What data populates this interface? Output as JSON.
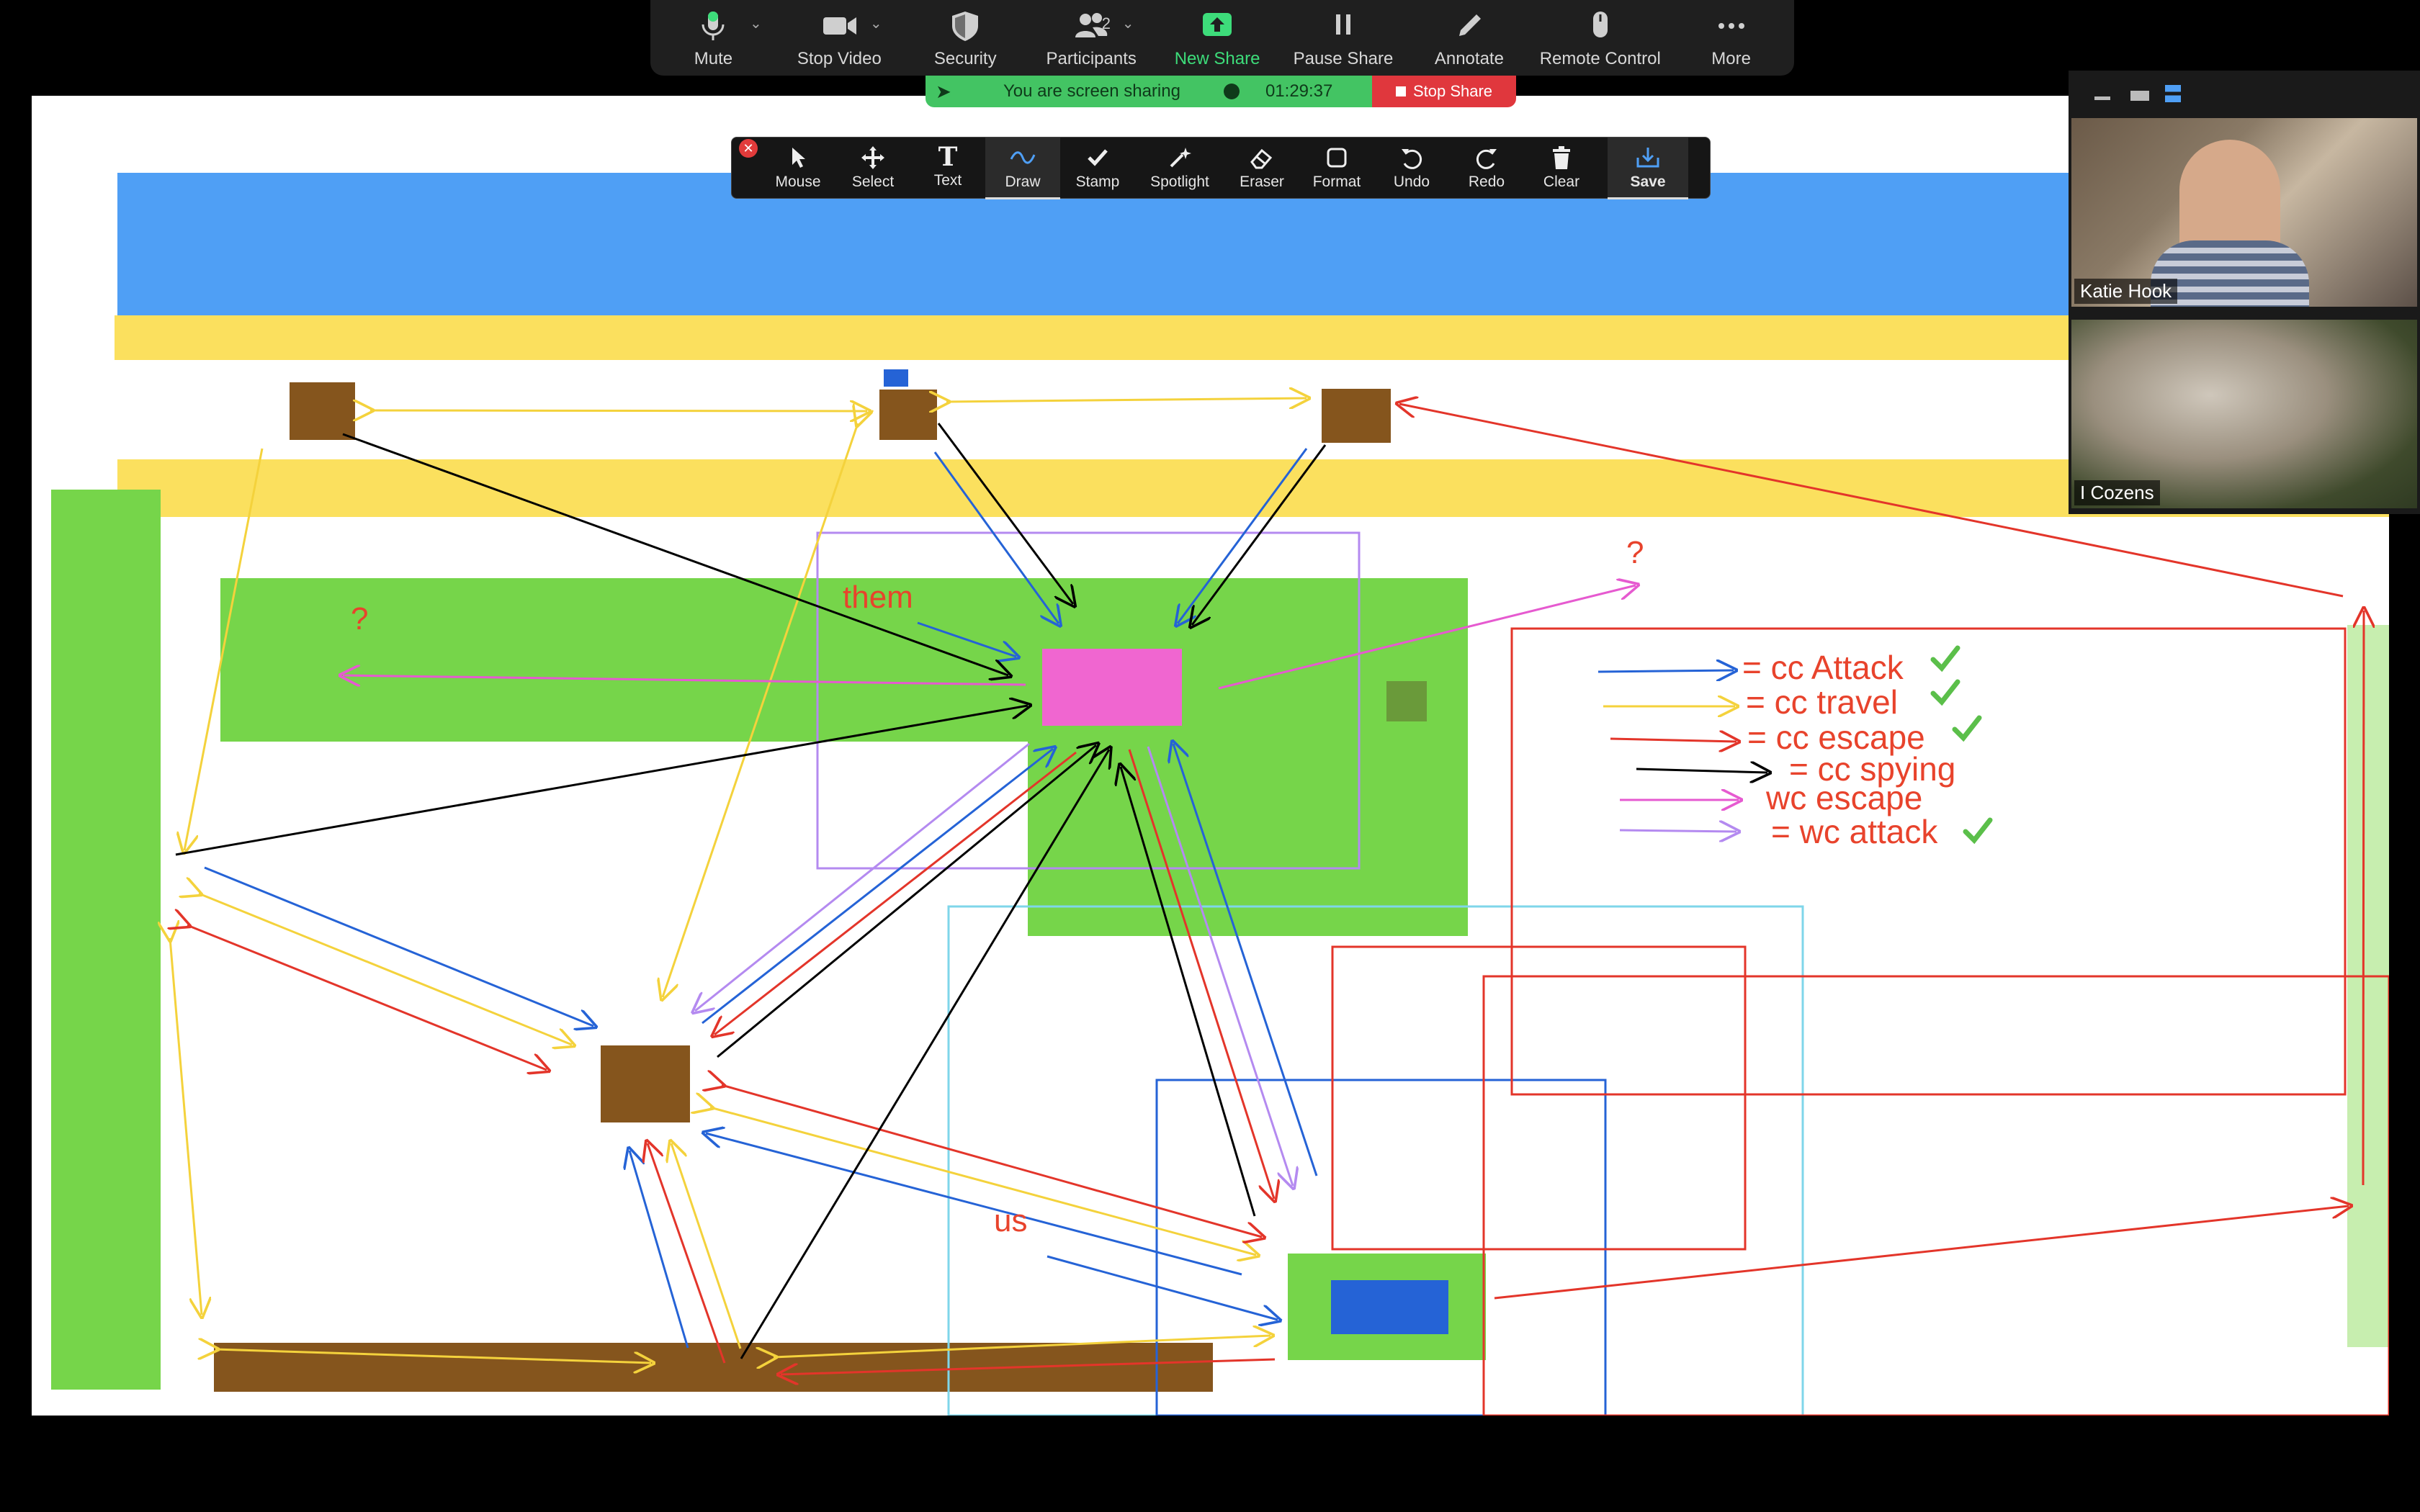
{
  "toolbar": {
    "items": [
      {
        "label": "Mute",
        "icon": "microphone-icon"
      },
      {
        "label": "Stop Video",
        "icon": "video-camera-icon"
      },
      {
        "label": "Security",
        "icon": "shield-icon"
      },
      {
        "label": "Participants",
        "icon": "participants-icon",
        "count": "2"
      },
      {
        "label": "New Share",
        "icon": "share-arrow-icon"
      },
      {
        "label": "Pause Share",
        "icon": "pause-icon"
      },
      {
        "label": "Annotate",
        "icon": "pencil-icon"
      },
      {
        "label": "Remote Control",
        "icon": "mouse-icon"
      },
      {
        "label": "More",
        "icon": "more-dots-icon"
      }
    ],
    "participant_count": "2"
  },
  "banner": {
    "text": "You are screen sharing",
    "timer": "01:29:37",
    "stop_label": "Stop Share"
  },
  "annotate": {
    "tools": [
      {
        "label": "Mouse"
      },
      {
        "label": "Select"
      },
      {
        "label": "Text"
      },
      {
        "label": "Draw"
      },
      {
        "label": "Stamp"
      },
      {
        "label": "Spotlight"
      },
      {
        "label": "Eraser"
      },
      {
        "label": "Format"
      },
      {
        "label": "Undo"
      },
      {
        "label": "Redo"
      },
      {
        "label": "Clear"
      },
      {
        "label": "Save"
      }
    ],
    "text_tool_glyph": "T"
  },
  "video": {
    "participants": [
      {
        "name": "Katie Hook"
      },
      {
        "name": "I Cozens"
      }
    ]
  },
  "canvas": {
    "labels": {
      "them": "them",
      "us": "us",
      "q1": "?",
      "q2": "?"
    },
    "legend": [
      {
        "text": "= cc Attack",
        "color": "#2563d6",
        "checked": true
      },
      {
        "text": "= cc travel",
        "color": "#f4d23c",
        "checked": true
      },
      {
        "text": "= cc escape",
        "color": "#e3352a",
        "checked": true
      },
      {
        "text": "= cc spying",
        "color": "#000000",
        "checked": false
      },
      {
        "text": "wc escape",
        "color": "#e65ad0",
        "checked": false
      },
      {
        "text": "= wc attack",
        "color": "#b48af0",
        "checked": true
      }
    ],
    "colors": {
      "blue": "#4f9ff5",
      "yellow": "#fbe05e",
      "green": "#76d54a",
      "brown": "#85551d",
      "pink": "#f066d0",
      "red": "#e3352a"
    }
  }
}
